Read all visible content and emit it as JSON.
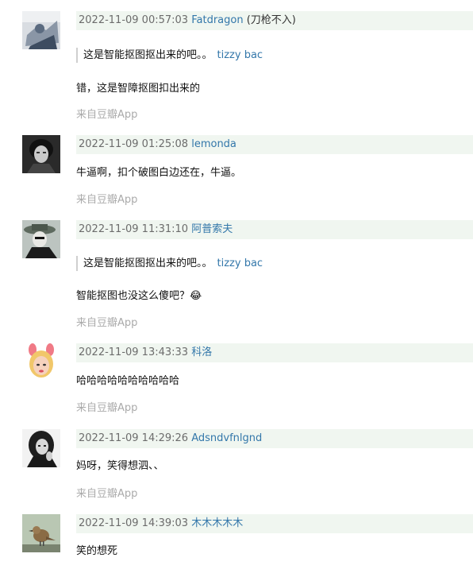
{
  "comments": [
    {
      "time": "2022-11-09 00:57:03",
      "author": "Fatdragon",
      "author_note": "(刀枪不入)",
      "quote": {
        "text": "这是智能抠图抠出来的吧。。",
        "author": "tizzy bac"
      },
      "text": "错，这是智障抠图扣出来的",
      "source": "来自豆瓣App",
      "avatar_icon": "user-photo-icon"
    },
    {
      "time": "2022-11-09 01:25:08",
      "author": "lemonda",
      "text": "牛逼啊，扣个破图白边还在，牛逼。",
      "source": "来自豆瓣App",
      "avatar_icon": "user-photo-icon"
    },
    {
      "time": "2022-11-09 11:31:10",
      "author": "阿普索夫",
      "quote": {
        "text": "这是智能抠图抠出来的吧。。",
        "author": "tizzy bac"
      },
      "text": "智能抠图也没这么傻吧？😂",
      "source": "来自豆瓣App",
      "avatar_icon": "user-photo-icon"
    },
    {
      "time": "2022-11-09 13:43:33",
      "author": "科洛",
      "text": "哈哈哈哈哈哈哈哈哈哈",
      "source": "来自豆瓣App",
      "avatar_icon": "user-photo-icon"
    },
    {
      "time": "2022-11-09 14:29:26",
      "author": "Adsndvfnlgnd",
      "text": "妈呀，笑得想泗、、",
      "source": "来自豆瓣App",
      "avatar_icon": "user-photo-icon"
    },
    {
      "time": "2022-11-09 14:39:03",
      "author": "木木木木木",
      "text": "笑的想死",
      "source": "",
      "avatar_icon": "user-photo-icon"
    }
  ],
  "colors": {
    "meta_background": "#f0f6f0",
    "author_link": "#3377aa",
    "timestamp": "#6c6c6c",
    "source_text": "#aaaaaa"
  }
}
